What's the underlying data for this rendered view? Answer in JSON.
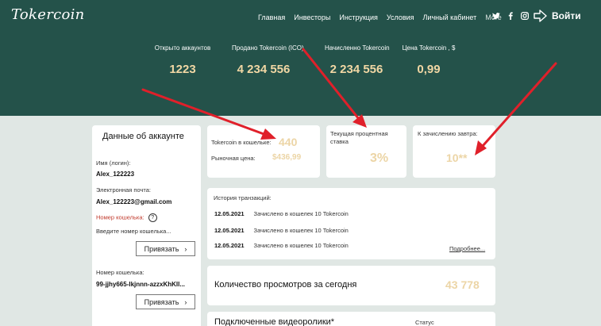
{
  "header": {
    "logo": "Tokercoin",
    "nav": [
      "Главная",
      "Инвесторы",
      "Инструкция",
      "Условия",
      "Личный кабинет",
      "More"
    ],
    "login_label": "Войти",
    "social_icons": [
      "twitter-icon",
      "facebook-icon",
      "instagram-icon"
    ]
  },
  "stats": [
    {
      "label": "Открыто аккаунтов",
      "value": "1223"
    },
    {
      "label": "Продано Tokercoin (ICO)",
      "value": "4 234 556"
    },
    {
      "label": "Начисленно Tokercoin",
      "value": "2 234 556"
    },
    {
      "label": "Цена Tokercoin , $",
      "value": "0,99"
    }
  ],
  "account": {
    "title": "Данные об аккаунте",
    "name_label": "Имя (логин):",
    "name_value": "Alex_122223",
    "email_label": "Электронная почта:",
    "email_value": "Alex_122223@gmail.com",
    "wallet_label": "Номер кошелька:",
    "wallet_help": "?",
    "wallet_placeholder": "Введите номер кошелька...",
    "bind_label": "Привязать",
    "wallet_number_label": "Номер кошелька:",
    "wallet_number_value": "99-jjhy665-lkjnnn-azzxKhKll...",
    "bind_label_2": "Привязать"
  },
  "wallet_card": {
    "balance_label": "Tokercoin в кошельке:",
    "balance_value": "440",
    "market_label": "Рыночная цена:",
    "market_value": "$436,99"
  },
  "rate_card": {
    "label": "Текущая процентная ставка",
    "value": "3%"
  },
  "tomorrow_card": {
    "label": "К зачислению завтра:",
    "value": "10**"
  },
  "transactions": {
    "title": "История транзакций:",
    "rows": [
      {
        "date": "12.05.2021",
        "text": "Зачислено в кошелек 10  Tokercoin"
      },
      {
        "date": "12.05.2021",
        "text": "Зачислено в кошелек 10  Tokercoin"
      },
      {
        "date": "12.05.2021",
        "text": "Зачислено в кошелек 10  Tokercoin"
      }
    ],
    "more_label": "Подробнее..."
  },
  "views": {
    "label": "Количество просмотров за сегодня",
    "value": "43 778"
  },
  "videos": {
    "label": "Подключенные видеоролики*",
    "status_label": "Статус"
  },
  "colors": {
    "header_bg": "#24524a",
    "page_bg": "#e0e7e4",
    "accent_gold": "#ecd5a6",
    "arrow_red": "#e0202a"
  }
}
